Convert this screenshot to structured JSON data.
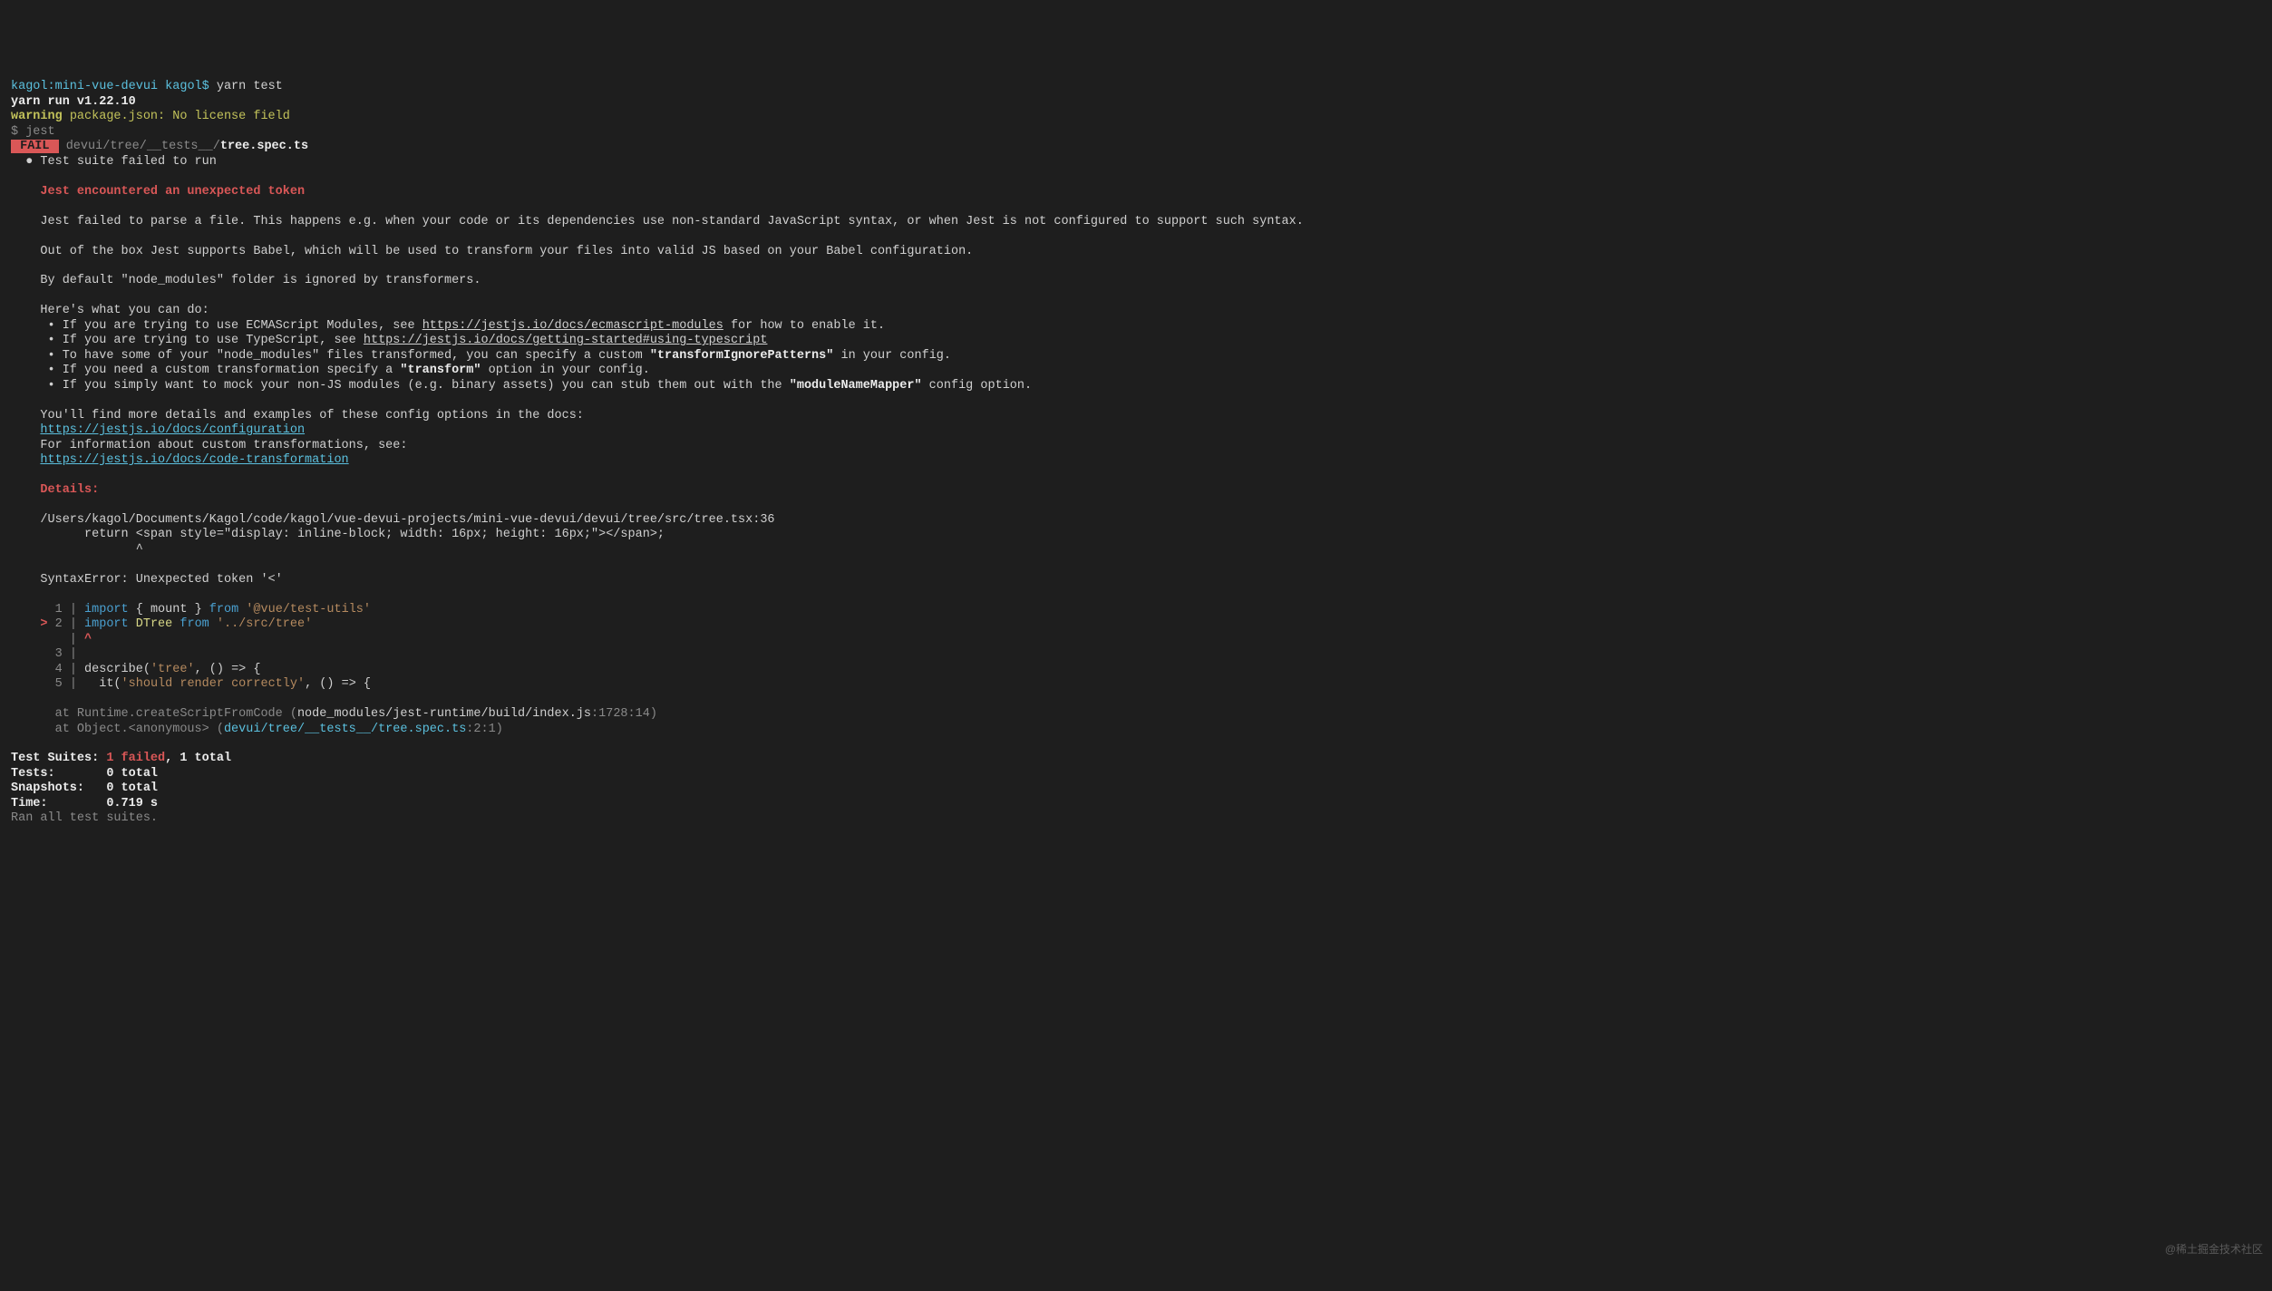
{
  "prompt": {
    "host": "kagol:mini-vue-devui",
    "user": "kagol$",
    "cmd": "yarn test"
  },
  "yarn_run": "yarn run v1.22.10",
  "warning_prefix": "warning",
  "warning_msg": " package.json: No license field",
  "jest_cmd": "$ jest",
  "fail_label": " FAIL ",
  "fail_path_dim": " devui/tree/__tests__/",
  "fail_path_bold": "tree.spec.ts",
  "suite_fail": "  ● Test suite failed to run",
  "err_title": "    Jest encountered an unexpected token",
  "para1": "    Jest failed to parse a file. This happens e.g. when your code or its dependencies use non-standard JavaScript syntax, or when Jest is not configured to support such syntax.",
  "para2": "    Out of the box Jest supports Babel, which will be used to transform your files into valid JS based on your Babel configuration.",
  "para3": "    By default \"node_modules\" folder is ignored by transformers.",
  "help_intro": "    Here's what you can do:",
  "b1_a": "     • If you are trying to use ECMAScript Modules, see ",
  "b1_link": "https://jestjs.io/docs/ecmascript-modules",
  "b1_b": " for how to enable it.",
  "b2_a": "     • If you are trying to use TypeScript, see ",
  "b2_link": "https://jestjs.io/docs/getting-started#using-typescript",
  "b3_a": "     • To have some of your \"node_modules\" files transformed, you can specify a custom ",
  "b3_bold": "\"transformIgnorePatterns\"",
  "b3_b": " in your config.",
  "b4_a": "     • If you need a custom transformation specify a ",
  "b4_bold": "\"transform\"",
  "b4_b": " option in your config.",
  "b5_a": "     • If you simply want to mock your non-JS modules (e.g. binary assets) you can stub them out with the ",
  "b5_bold": "\"moduleNameMapper\"",
  "b5_b": " config option.",
  "more_a": "    You'll find more details and examples of these config options in the docs:",
  "link_conf": "https://jestjs.io/docs/configuration",
  "more_b": "    For information about custom transformations, see:",
  "link_trans": "https://jestjs.io/docs/code-transformation",
  "details": "    Details:",
  "file_loc": "    /Users/kagol/Documents/Kagol/code/kagol/vue-devui-projects/mini-vue-devui/devui/tree/src/tree.tsx:36",
  "return_line": "          return <span style=\"display: inline-block; width: 16px; height: 16px;\"></span>;",
  "caret": "                 ^",
  "syntax_err": "    SyntaxError: Unexpected token '<'",
  "l1_num": "      1",
  "l1_import": "import",
  "l1_brace": " { ",
  "l1_mount": "mount",
  "l1_brace2": " } ",
  "l1_from": "from",
  "l1_str": " '@vue/test-utils'",
  "l2_gt": "    >",
  "l2_num": " 2",
  "l2_import": "import",
  "l2_sp": " ",
  "l2_dtree": "DTree",
  "l2_from": "from",
  "l2_str": " '../src/tree'",
  "l2_caret_line": "        | ",
  "l2_caret": "^",
  "l3_num": "      3",
  "pipe": " | ",
  "l4_num": "      4",
  "l4_desc": "describe(",
  "l4_str": "'tree'",
  "l4_rest": ", () => {",
  "l5_num": "      5",
  "l5_it": "  it(",
  "l5_str": "'should render correctly'",
  "l5_rest": ", () => {",
  "st1_a": "      at Runtime.createScriptFromCode (",
  "st1_b": "node_modules/jest-runtime/build/index.js",
  "st1_c": ":1728:14)",
  "st2_a": "      at Object.<anonymous> (",
  "st2_b": "devui/tree/__tests__/tree.spec.ts",
  "st2_c": ":2:1)",
  "summary_suites_label": "Test Suites: ",
  "summary_suites_fail": "1 failed",
  "summary_suites_rest": ", 1 total",
  "summary_tests": "Tests:       0 total",
  "summary_snaps": "Snapshots:   0 total",
  "summary_time": "Time:        0.719 s",
  "ran_all": "Ran all test suites.",
  "watermark": "@稀土掘金技术社区"
}
